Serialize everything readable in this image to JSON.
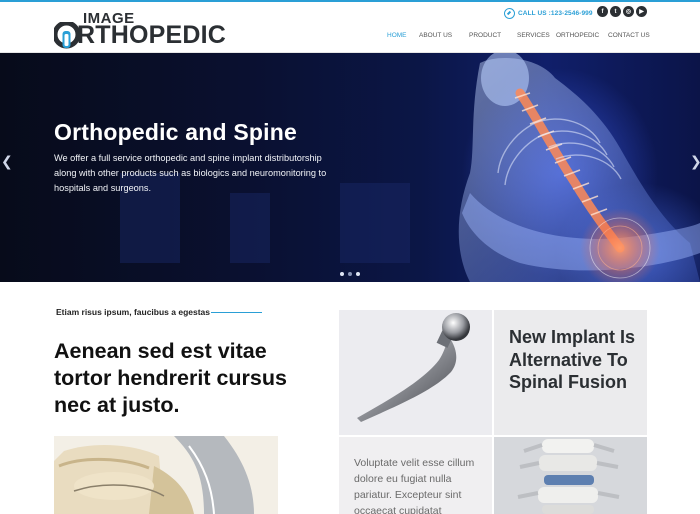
{
  "brand": {
    "name_top": "IMAGE",
    "name_main": "ORTHOPEDIC",
    "accent_color": "#2a9fd6"
  },
  "contact": {
    "phone_label": "CALL US :123-2546-999",
    "icon": "phone-icon"
  },
  "socials": [
    {
      "icon": "facebook-icon",
      "glyph": "f"
    },
    {
      "icon": "twitter-icon",
      "glyph": "t"
    },
    {
      "icon": "instagram-icon",
      "glyph": "◎"
    },
    {
      "icon": "youtube-icon",
      "glyph": "▶"
    }
  ],
  "nav": {
    "items": [
      "HOME",
      "ABOUT US",
      "PRODUCT",
      "SERVICES",
      "ORTHOPEDIC",
      "CONTACT US"
    ],
    "active": "HOME"
  },
  "hero": {
    "title": "Orthopedic and Spine",
    "description": "We offer a full service orthopedic and spine implant distributorship along with other products such as biologics and neuromonitoring to hospitals and surgeons.",
    "prev_glyph": "❮",
    "next_glyph": "❯",
    "slide_count": 3,
    "active_slide": 2
  },
  "intro": {
    "eyebrow": "Etiam risus ipsum, faucibus a egestas",
    "heading": "Aenean sed est vitae tortor hendrerit cursus nec at justo."
  },
  "tiles": {
    "feature_title": "New Implant Is Alternative To Spinal Fusion",
    "body_text": "Voluptate velit esse cillum dolore eu fugiat nulla pariatur. Excepteur sint occaecat cupidatat"
  }
}
